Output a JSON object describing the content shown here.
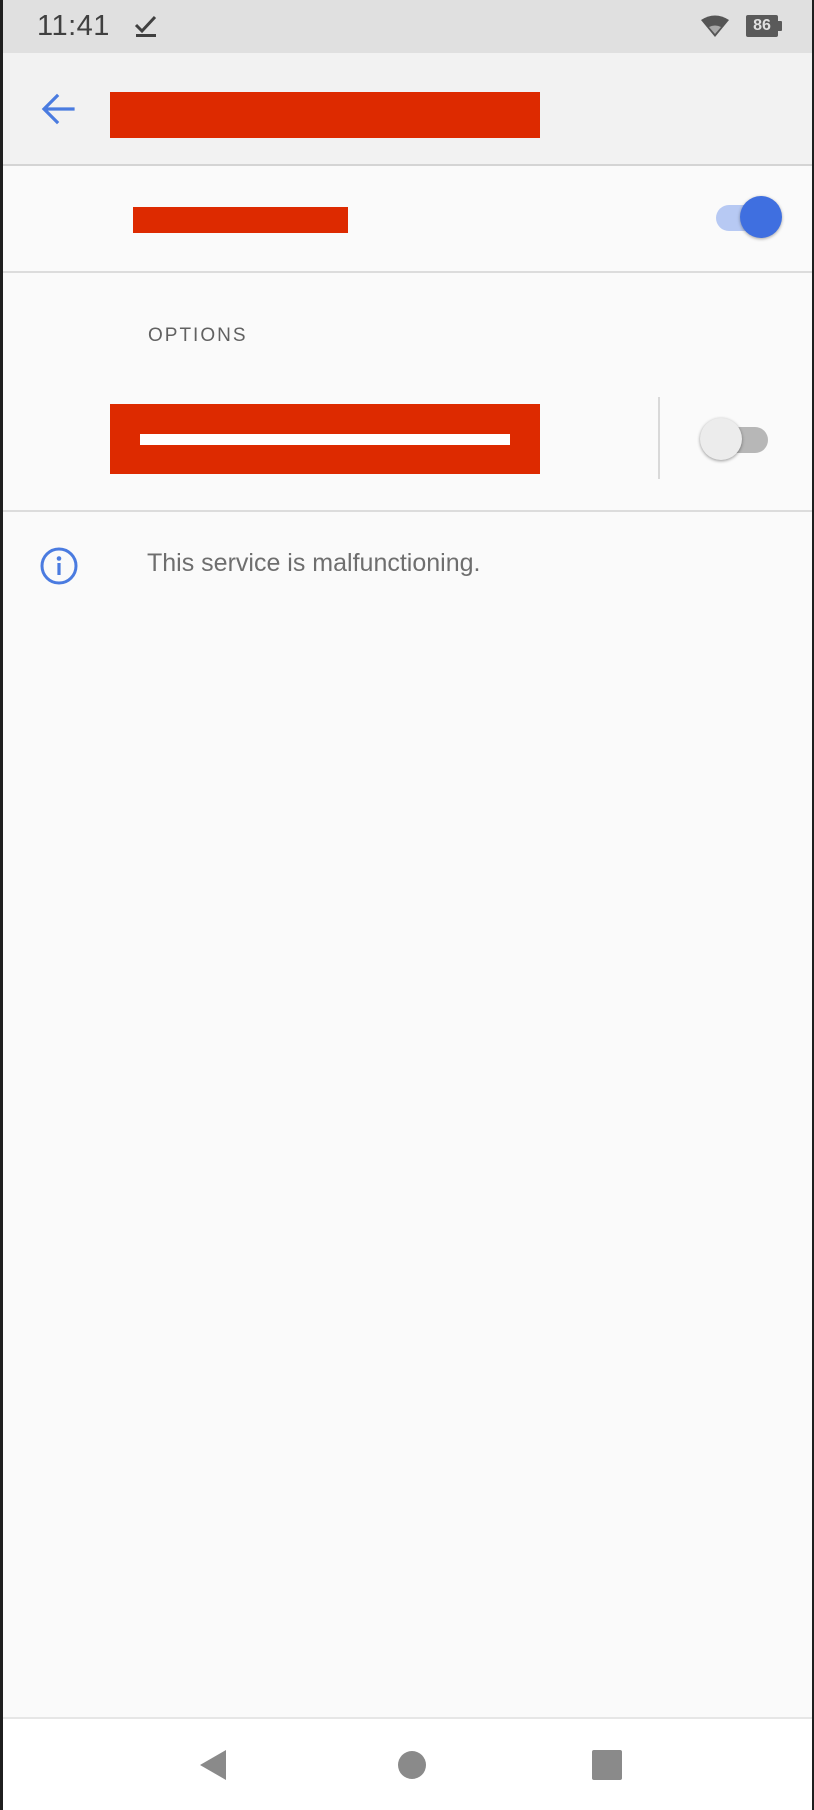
{
  "status_bar": {
    "time": "11:41",
    "battery_level": "86",
    "icons": [
      "download-done-icon",
      "wifi-icon",
      "battery-icon"
    ]
  },
  "app_bar": {
    "back_icon": "arrow-back-icon",
    "title": ""
  },
  "main_switch": {
    "label": "",
    "checked": true
  },
  "options": {
    "header": "OPTIONS",
    "items": [
      {
        "label": "",
        "checked": false
      }
    ]
  },
  "info": {
    "icon": "info-icon",
    "message": "This service is malfunctioning."
  },
  "navigation": {
    "buttons": [
      "nav-back-icon",
      "nav-home-icon",
      "nav-recents-icon"
    ]
  },
  "colors": {
    "accent": "#3f6fe0",
    "accent_track": "#b7c9f3",
    "redaction": "#dd2a00",
    "background": "#fafafa"
  }
}
